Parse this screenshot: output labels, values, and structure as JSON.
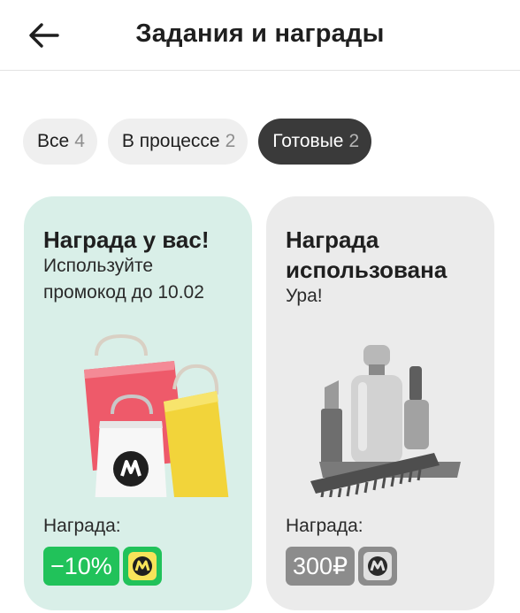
{
  "header": {
    "title": "Задания и награды",
    "back_icon": "arrow-left-icon"
  },
  "tabs": [
    {
      "label": "Все",
      "count": "4",
      "active": false
    },
    {
      "label": "В процессе",
      "count": "2",
      "active": false
    },
    {
      "label": "Готовые",
      "count": "2",
      "active": true
    }
  ],
  "cards": [
    {
      "title": "Награда у вас!",
      "subtitle": "Используйте промокод до 10.02",
      "illustration": "shopping-bags",
      "reward_label": "Награда:",
      "reward_value": "−10%",
      "badge_icon": "market-logo-icon",
      "color": "#d9efe8",
      "accent": "#21c25a"
    },
    {
      "title": "Награда использована",
      "subtitle": "Ура!",
      "illustration": "cosmetics",
      "reward_label": "Награда:",
      "reward_value": "300₽",
      "badge_icon": "market-logo-icon",
      "color": "#ebebeb",
      "accent": "#8c8c8c"
    }
  ]
}
